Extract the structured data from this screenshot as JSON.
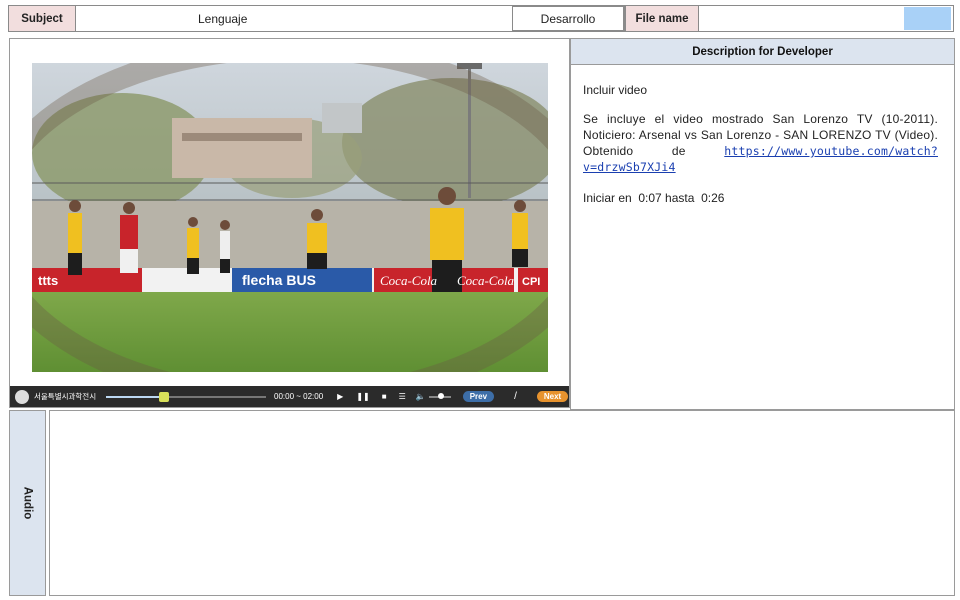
{
  "header": {
    "subject_label": "Subject",
    "subject_value": "Lenguaje",
    "subject_extra": "Desarrollo",
    "file_name_label": "File name",
    "file_name_value": ""
  },
  "player": {
    "logo_text": "서울특별시과학전시관",
    "time": "00:00 ~ 02:00",
    "prev_label": "Prev",
    "separator": "/",
    "next_label": "Next",
    "progress": 0.36,
    "volume": 0.55
  },
  "video": {
    "signs": [
      "ttts",
      "flecha BUS",
      "Coca-Cola",
      "Coca-Cola",
      "CPI"
    ]
  },
  "description": {
    "title": "Description for Developer",
    "line1": "Incluir video",
    "para_text": "Se incluye el video mostrado San Lorenzo TV (10-2011). Noticiero: Arsenal vs San Lorenzo - SAN LORENZO TV (Video). Obtenido de",
    "link": "https://www.youtube.com/watch?v=drzwSb7XJi4",
    "line3": "Iniciar en  0:07 hasta  0:26"
  },
  "audio": {
    "label": "Audio"
  },
  "colors": {
    "header_label_bg": "#f2dede",
    "panel_title_bg": "#dce4ef",
    "file_box_accent": "#a9d1f7",
    "link": "#1a3fb0",
    "next_button": "#e8932e",
    "prev_button": "#3d6ea8"
  }
}
